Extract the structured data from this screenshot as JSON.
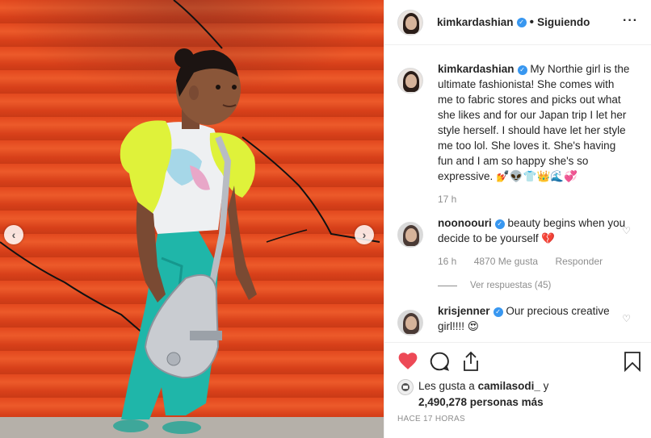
{
  "post": {
    "author": "kimkardashian",
    "follow_status": "Siguiendo",
    "more_label": "···"
  },
  "caption": {
    "username": "kimkardashian",
    "text": "My Northie girl is the ultimate fashionista! She comes with me to fabric stores and picks out what she likes and for our Japan trip I let her style herself. I should have let her style me too lol. She loves it. She's having fun and I am so happy she's so expressive. 💅👽👕👑🌊💞",
    "time": "17 h"
  },
  "comments": [
    {
      "username": "noonoouri",
      "text": "beauty begins when you decide to be yourself 💔",
      "time": "16 h",
      "likes": "4870 Me gusta",
      "reply": "Responder",
      "view_replies": "Ver respuestas (45)"
    },
    {
      "username": "krisjenner",
      "text": "Our precious creative girl!!!! 😍"
    }
  ],
  "likes": {
    "prefix": "Les gusta a",
    "user": "camilasodi_",
    "conj": "y",
    "count": "2,490,278 personas más"
  },
  "timestamp": "HACE 17 HORAS",
  "icons": {
    "like": "heart-icon",
    "comment": "comment-icon",
    "share": "share-icon",
    "save": "bookmark-icon",
    "prev": "chevron-left-icon",
    "next": "chevron-right-icon"
  },
  "colors": {
    "like_red": "#ed4956",
    "verified_blue": "#3897f0",
    "muted": "#8e8e8e",
    "door_orange": "#e2481e"
  }
}
